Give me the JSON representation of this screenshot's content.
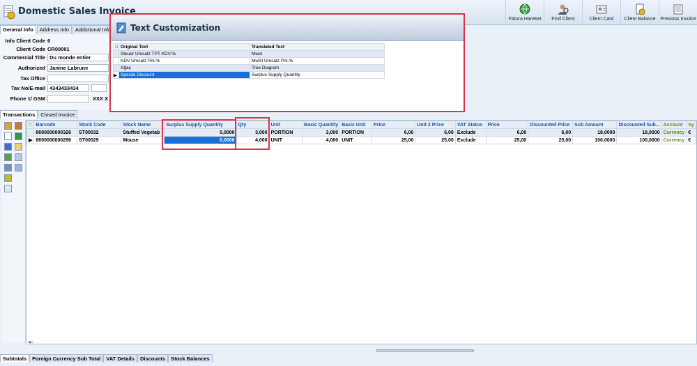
{
  "app": {
    "title": "Domestic Sales Invoice"
  },
  "toolbar": [
    {
      "label": "Fatura Hareket",
      "icon": "globe-icon"
    },
    {
      "label": "Find Client",
      "icon": "find-client-icon"
    },
    {
      "label": "Client Card",
      "icon": "client-card-icon"
    },
    {
      "label": "Client Balance",
      "icon": "client-balance-icon"
    },
    {
      "label": "Previous Invoice",
      "icon": "previous-invoice-icon"
    }
  ],
  "top_tabs": [
    {
      "label": "General Info"
    },
    {
      "label": "Address Info"
    },
    {
      "label": "Addictional Info"
    }
  ],
  "form": {
    "info_client_code": {
      "label": "Info Client Code",
      "value": "6"
    },
    "client_code": {
      "label": "Client Code",
      "value": "CR00001"
    },
    "commercial_title": {
      "label": "Commercial Title",
      "value": "Du monde entier"
    },
    "authorized": {
      "label": "Authorized",
      "value": "Janine Labrune"
    },
    "tax_office": {
      "label": "Tax Office",
      "value": ""
    },
    "tax_no": {
      "label": "Tax No/E-mail",
      "value": "4343433434"
    },
    "phone": {
      "label": "Phone 1/ GSM",
      "value": "",
      "extra": "XXX X"
    }
  },
  "dialog": {
    "title": "Text Customization",
    "columns": [
      "Original Text",
      "Translated Text"
    ],
    "rows": [
      {
        "original": "Steuer Umsatz TPT KDV.%",
        "translated": "Mwst"
      },
      {
        "original": "KDV Umsatz Prk.%",
        "translated": "MwSt Umsatz Prk.%"
      },
      {
        "original": "Ağaç",
        "translated": "Tree Diagram"
      },
      {
        "original": "Special Discount",
        "translated": "Surplus Supply Quantity"
      }
    ]
  },
  "tx_tabs": [
    {
      "label": "Transactions"
    },
    {
      "label": "Closed Invoice"
    }
  ],
  "grid": {
    "columns": [
      "Barcode",
      "Stock Code",
      "Stock Name",
      "Surplus Supply Quantity",
      "Qty",
      "Unit",
      "Basic Quantity",
      "Basic Unit",
      "Price",
      "Unit 2 Price",
      "VAT Status",
      "Price",
      "Discounted Price",
      "Sub Amount",
      "Discounted Sub...",
      "Account",
      "Sy"
    ],
    "rows": [
      [
        "8690000000326",
        "ST00032",
        "Stuffed Vegetab",
        "0,0000",
        "3,000",
        "PORTION",
        "3,000",
        "PORTION",
        "6,00",
        "6,00",
        "Exclude",
        "6,00",
        "6,00",
        "18,0000",
        "18,0000",
        "Currency",
        "€"
      ],
      [
        "8690000000296",
        "ST00029",
        "Mouse",
        "0,0000",
        "4,000",
        "UNIT",
        "4,000",
        "UNIT",
        "25,00",
        "25,00",
        "Exclude",
        "25,00",
        "25,00",
        "100,0000",
        "100,0000",
        "Currency",
        "€"
      ]
    ]
  },
  "bottom_tabs": [
    {
      "label": "Subtotals"
    },
    {
      "label": "Foreign Currency Sub Total"
    },
    {
      "label": "VAT Details"
    },
    {
      "label": "Discounts"
    },
    {
      "label": "Stock Balances"
    }
  ]
}
